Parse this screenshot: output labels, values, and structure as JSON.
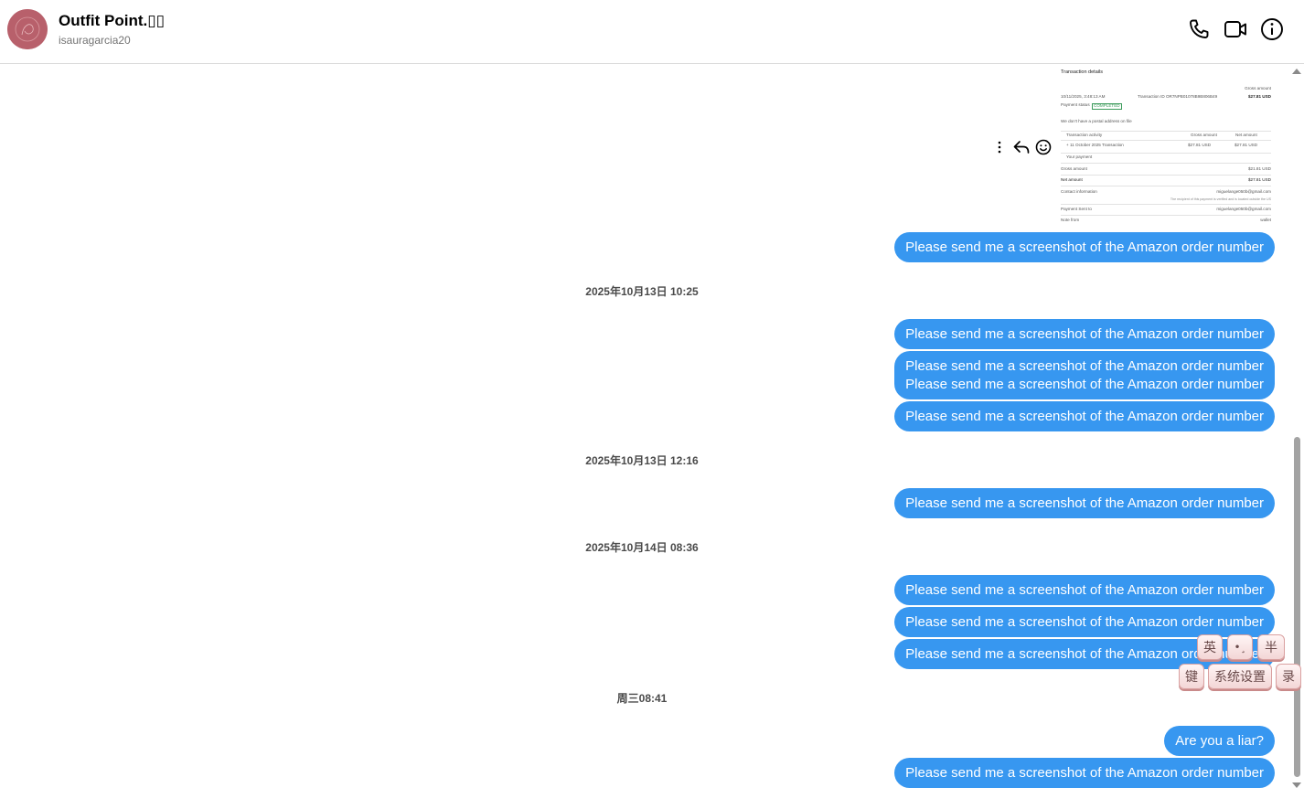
{
  "header": {
    "title": "Outfit Point.▯▯",
    "username": "isauragarcia20"
  },
  "transaction_image": {
    "heading": "Transaction details",
    "gross_amount_label": "Gross amount",
    "date": "10/11/2025, 3:48:13 AM",
    "transaction_id": "Transaction ID  OR7NPB01078B9B806B49",
    "amount": "$27.81 USD",
    "payment_status_label": "Payment status",
    "payment_status": "COMPLETED",
    "postal_note": "We don't have a postal address on file",
    "col_activity": "Transaction activity",
    "col_gross": "Gross amount",
    "col_net": "Net amount",
    "activity_row": "+ 11 October 2025 Transaction",
    "activity_gross": "$27.81 USD",
    "activity_net": "$27.81 USD",
    "your_payment": "Your payment",
    "gross_label": "Gross amount",
    "gross_value": "$21.81 USD",
    "net_label": "Net amount",
    "net_value": "$27.81 USD",
    "contact_label": "Contact information",
    "contact_value": "miguelange050b@gmail.com",
    "recipient_note": "The recipient of this payment is verified and is located outside the US",
    "sent_to_label": "Payment Sent to",
    "sent_to_value": "miguelange050b@gmail.com",
    "note_label": "Note from",
    "note_value": "wallet"
  },
  "messages": [
    {
      "type": "bubble",
      "text": "Please send me a screenshot of the Amazon order number"
    },
    {
      "type": "timestamp",
      "text": "2025年10月13日 10:25"
    },
    {
      "type": "bubble",
      "text": "Please send me a screenshot of the Amazon order number"
    },
    {
      "type": "bubble",
      "text": "Please send me a screenshot of the Amazon order number",
      "text2": "Please send me a screenshot of the Amazon order number"
    },
    {
      "type": "bubble",
      "text": "Please send me a screenshot of the Amazon order number"
    },
    {
      "type": "timestamp",
      "text": "2025年10月13日 12:16"
    },
    {
      "type": "bubble",
      "text": "Please send me a screenshot of the Amazon order number"
    },
    {
      "type": "timestamp",
      "text": "2025年10月14日 08:36"
    },
    {
      "type": "bubble",
      "text": "Please send me a screenshot of the Amazon order number"
    },
    {
      "type": "bubble",
      "text": "Please send me a screenshot of the Amazon order number"
    },
    {
      "type": "bubble",
      "text": "Please send me a screenshot of the Amazon order number"
    },
    {
      "type": "timestamp",
      "text": "周三08:41"
    },
    {
      "type": "bubble",
      "text": "Are you a liar?"
    },
    {
      "type": "bubble",
      "text": "Please send me a screenshot of the Amazon order number"
    }
  ],
  "ime_toolbar": {
    "lang": "英",
    "punct": "•¸",
    "width": "半",
    "keyboard": "键",
    "settings": "系统设置",
    "record": "录"
  },
  "colors": {
    "bubble": "#3797f0",
    "avatar": "#b8606b"
  }
}
